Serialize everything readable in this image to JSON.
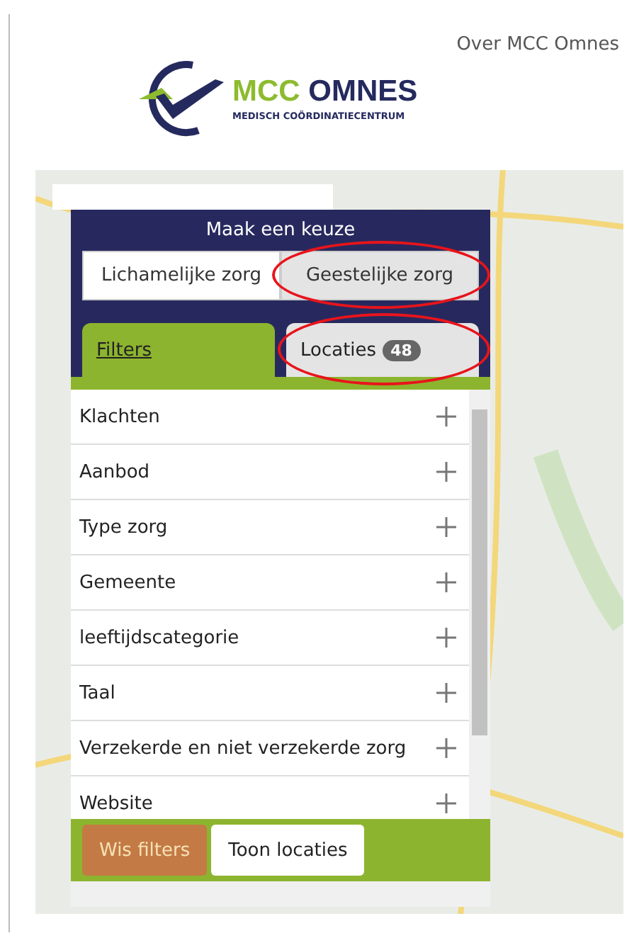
{
  "header": {
    "nav_link": "Over MCC Omnes",
    "logo": {
      "brand_first": "MCC",
      "brand_second": "OMNES",
      "tagline": "MEDISCH COÖRDINATIECENTRUM"
    }
  },
  "panel": {
    "title": "Maak een keuze",
    "care_types": [
      {
        "label": "Lichamelijke zorg",
        "selected": true,
        "circled": false
      },
      {
        "label": "Geestelijke zorg",
        "selected": false,
        "circled": true
      }
    ],
    "tabs": [
      {
        "label": "Filters",
        "selected": true,
        "circled": false
      },
      {
        "label": "Locaties",
        "badge": "48",
        "selected": false,
        "circled": true
      }
    ],
    "filters": [
      {
        "label": "Klachten",
        "expanded": false
      },
      {
        "label": "Aanbod",
        "expanded": false
      },
      {
        "label": "Type zorg",
        "expanded": false
      },
      {
        "label": "Gemeente",
        "expanded": false
      },
      {
        "label": "leeftijdscategorie",
        "expanded": false
      },
      {
        "label": "Taal",
        "expanded": false
      },
      {
        "label": "Verzekerde en niet verzekerde zorg",
        "expanded": false
      },
      {
        "label": "Website",
        "expanded": false
      }
    ],
    "buttons": [
      {
        "label": "Wis filters",
        "kind": "clear"
      },
      {
        "label": "Toon locaties",
        "kind": "show"
      }
    ]
  }
}
